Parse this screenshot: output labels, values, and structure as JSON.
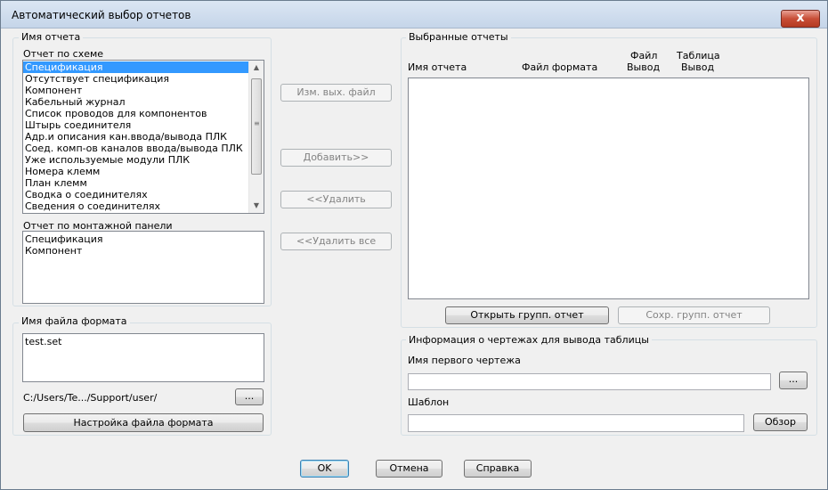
{
  "window": {
    "title": "Автоматический выбор отчетов",
    "close_label": "x"
  },
  "left": {
    "report_name_group": "Имя отчета",
    "schema_label": "Отчет по схеме",
    "schema_items": [
      "Спецификация",
      "Отсутствует спецификация",
      "Компонент",
      "Кабельный журнал",
      "Список проводов для компонентов",
      "Штырь соединителя",
      "Адр.и описания кан.ввода/вывода ПЛК",
      "Соед. комп-ов каналов ввода/вывода ПЛК",
      "Уже используемые модули ПЛК",
      "Номера клемм",
      "План клемм",
      "Сводка о соединителях",
      "Сведения о соединителях"
    ],
    "panel_label": "Отчет по монтажной панели",
    "panel_items": [
      "Спецификация",
      "Компонент"
    ],
    "format_group": "Имя файла формата",
    "format_items": [
      "test.set"
    ],
    "path": "C:/Users/Te.../Support/user/",
    "browse_small": "...",
    "format_settings_button": "Настройка файла формата"
  },
  "middle": {
    "change_output_button": "Изм. вых. файл",
    "add_button": "Добавить>>",
    "remove_button": "<<Удалить",
    "remove_all_button": "<<Удалить все"
  },
  "right": {
    "selected_group": "Выбранные отчеты",
    "col_name": "Имя отчета",
    "col_format": "Файл формата",
    "col_file_top": "Файл",
    "col_file_bottom": "Вывод",
    "col_table_top": "Таблица",
    "col_table_bottom": "Вывод",
    "open_group_button": "Открыть групп. отчет",
    "save_group_button": "Сохр. групп. отчет",
    "drawing_info_group": "Информация о чертежах для вывода таблицы",
    "first_drawing_label": "Имя первого чертежа",
    "first_drawing_value": "",
    "first_drawing_browse": "...",
    "template_label": "Шаблон",
    "template_value": "",
    "template_browse": "Обзор"
  },
  "footer": {
    "ok": "OK",
    "cancel": "Отмена",
    "help": "Справка"
  }
}
